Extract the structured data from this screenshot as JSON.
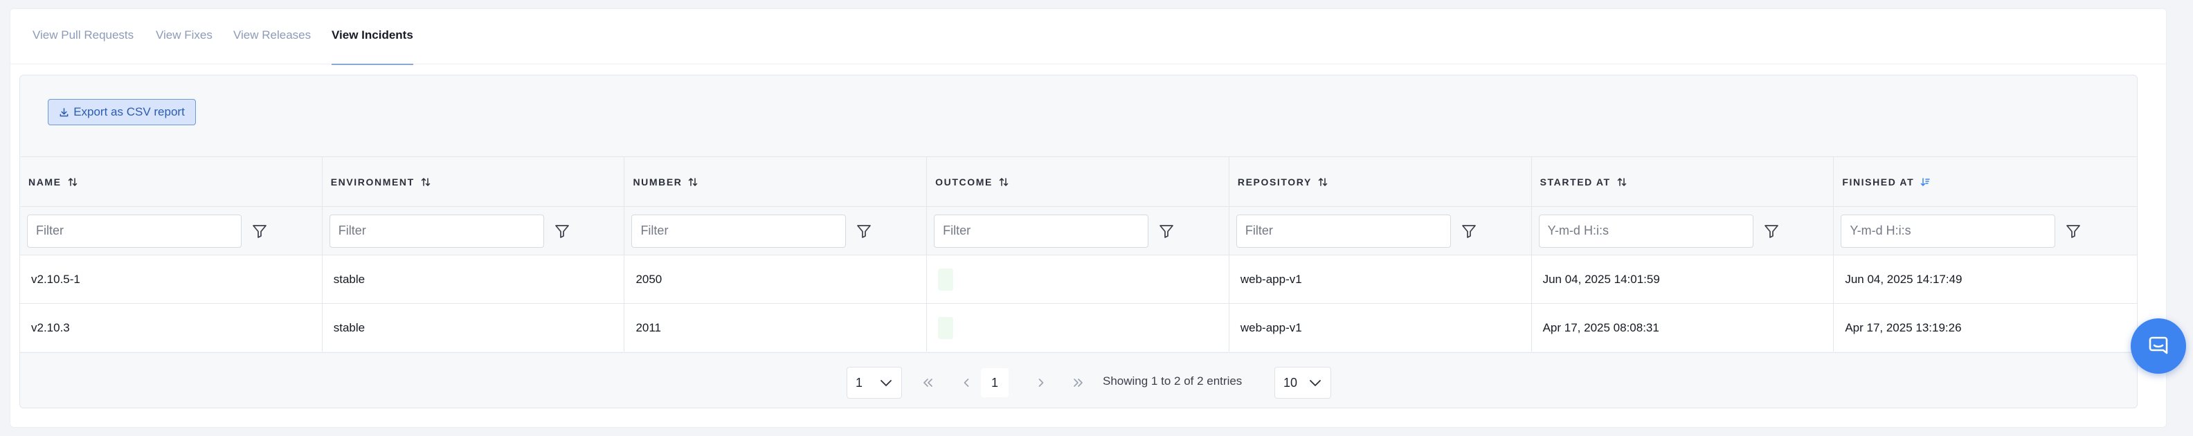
{
  "tabs": [
    {
      "label": "View Pull Requests",
      "active": false
    },
    {
      "label": "View Fixes",
      "active": false
    },
    {
      "label": "View Releases",
      "active": false
    },
    {
      "label": "View Incidents",
      "active": true
    }
  ],
  "toolbar": {
    "export_label": "Export as CSV report"
  },
  "table": {
    "columns": [
      {
        "label": "NAME",
        "sort": "none"
      },
      {
        "label": "ENVIRONMENT",
        "sort": "none"
      },
      {
        "label": "NUMBER",
        "sort": "none"
      },
      {
        "label": "OUTCOME",
        "sort": "none"
      },
      {
        "label": "REPOSITORY",
        "sort": "none"
      },
      {
        "label": "STARTED AT",
        "sort": "none"
      },
      {
        "label": "FINISHED AT",
        "sort": "desc"
      }
    ],
    "filters": [
      {
        "placeholder": "Filter",
        "value": ""
      },
      {
        "placeholder": "Filter",
        "value": ""
      },
      {
        "placeholder": "Filter",
        "value": ""
      },
      {
        "placeholder": "Filter",
        "value": ""
      },
      {
        "placeholder": "Filter",
        "value": ""
      },
      {
        "placeholder": "Y-m-d H:i:s",
        "value": ""
      },
      {
        "placeholder": "Y-m-d H:i:s",
        "value": ""
      }
    ],
    "rows": [
      {
        "name": "v2.10.5-1",
        "environment": "stable",
        "number": "2050",
        "repository": "web-app-v1",
        "started_at": "Jun 04, 2025 14:01:59",
        "finished_at": "Jun 04, 2025 14:17:49"
      },
      {
        "name": "v2.10.3",
        "environment": "stable",
        "number": "2011",
        "repository": "web-app-v1",
        "started_at": "Apr 17, 2025 08:08:31",
        "finished_at": "Apr 17, 2025 13:19:26"
      }
    ]
  },
  "pagination": {
    "page_select": "1",
    "current_page": "1",
    "showing_text": "Showing 1 to 2 of 2 entries",
    "page_size": "10"
  },
  "colors": {
    "accent": "#3d84f0",
    "tab_active_underline": "#8aa7d6",
    "export_bg": "#d7e4fb",
    "export_border": "#6f98d8",
    "outcome_success": "#eef9f0"
  },
  "icons": {
    "export": "download-icon",
    "sort": "sort-arrows-icon",
    "sort_active": "sort-desc-icon",
    "filter": "funnel-icon",
    "chat": "chat-bubble-icon"
  }
}
